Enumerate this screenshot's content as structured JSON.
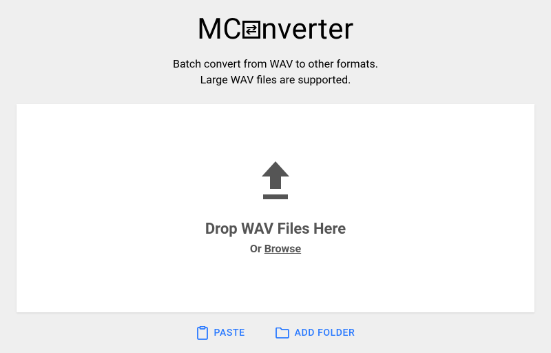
{
  "logo": {
    "pre": "MC",
    "post": "nverter"
  },
  "subtitle_line1": "Batch convert from WAV to other formats.",
  "subtitle_line2": "Large WAV files are supported.",
  "dropzone": {
    "title": "Drop WAV Files Here",
    "or": "Or ",
    "browse": "Browse"
  },
  "actions": {
    "paste": "PASTE",
    "add_folder": "ADD FOLDER"
  },
  "colors": {
    "accent": "#2979ff",
    "muted": "#555"
  }
}
